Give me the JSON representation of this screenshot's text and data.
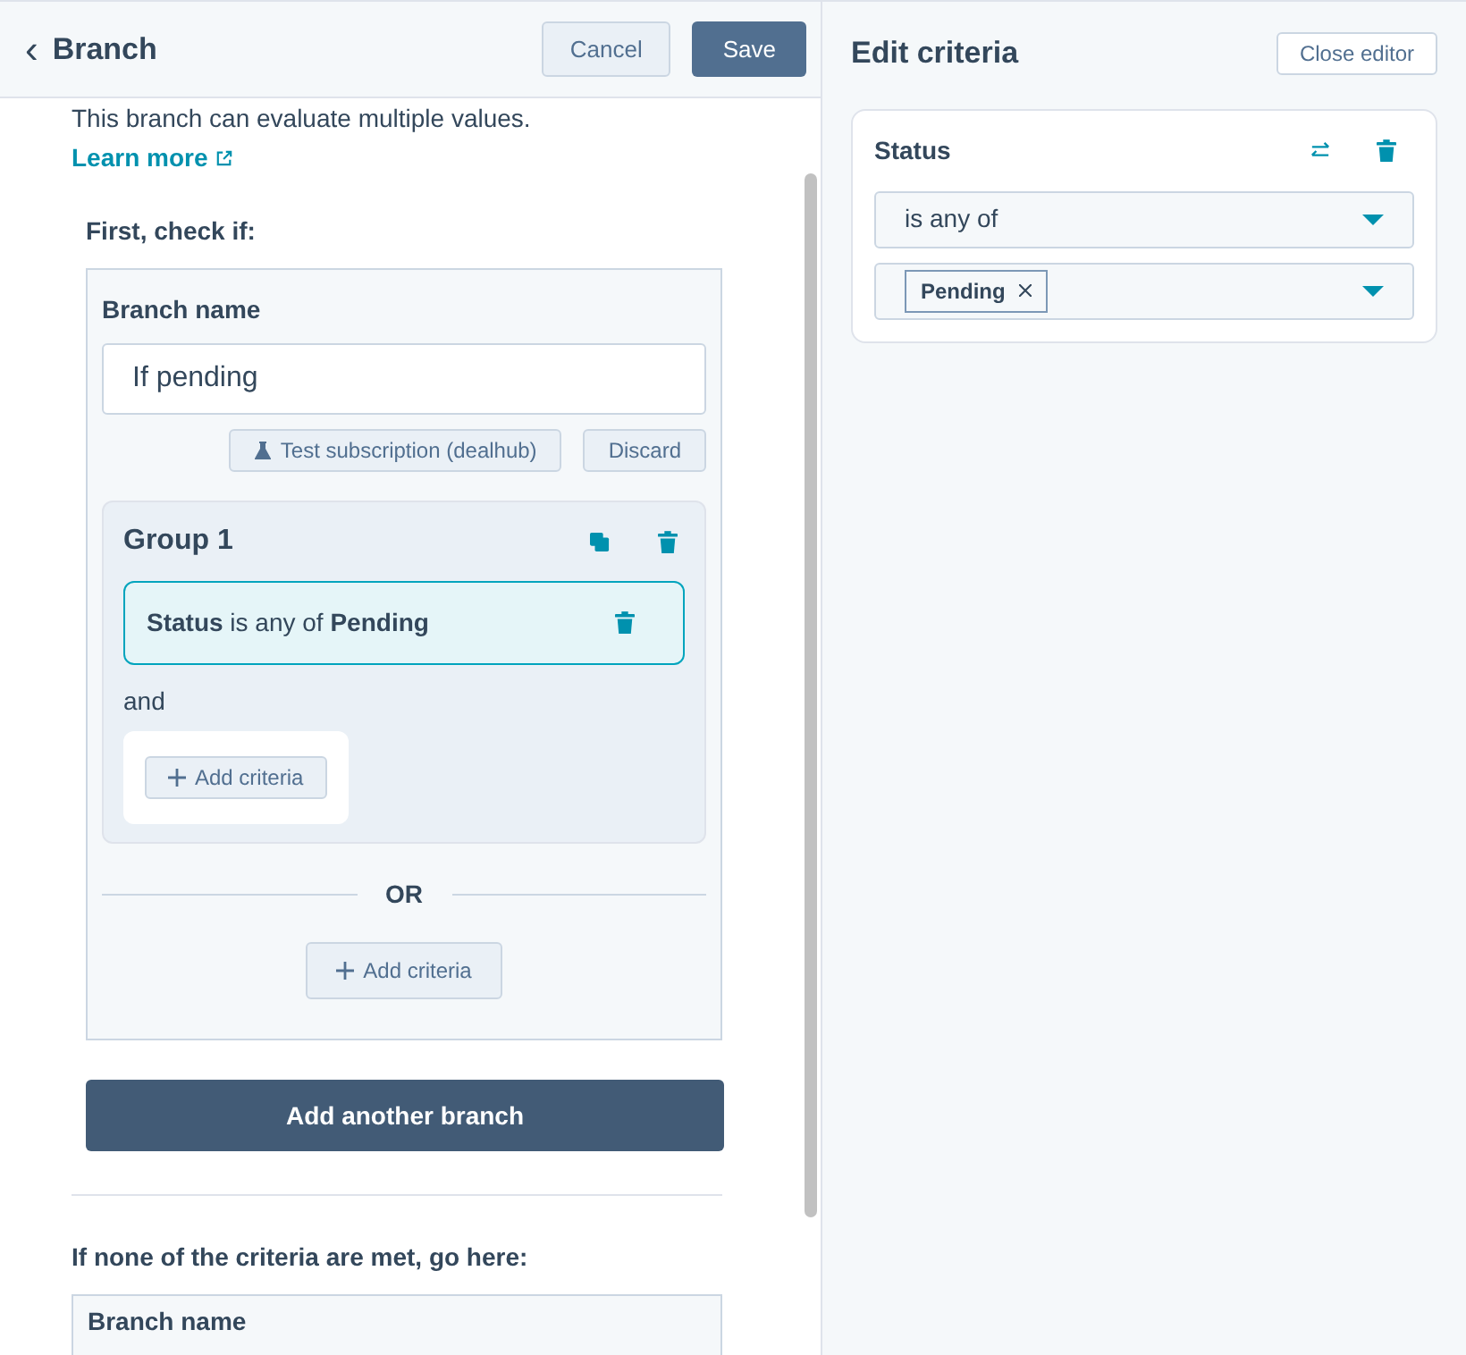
{
  "header": {
    "back": "‹",
    "title": "Branch",
    "buttons": [
      {
        "label": "Cancel",
        "kind": "secondary"
      },
      {
        "label": "Save",
        "kind": "primary"
      }
    ]
  },
  "intro": {
    "text": "This branch can evaluate multiple values.",
    "link": "Learn more"
  },
  "first_check": "First, check if:",
  "branch": {
    "name_label": "Branch name",
    "name_value": "If pending",
    "actions": [
      {
        "label": "Test subscription (dealhub)",
        "kind": "test"
      },
      {
        "label": "Discard",
        "kind": "plain"
      }
    ],
    "group": {
      "title": "Group 1",
      "criteria": [
        {
          "text": "**Status** is any of **Pending**",
          "selected": true
        }
      ],
      "joiner": "and",
      "add": "Add criteria"
    },
    "or": "OR",
    "add": "Add criteria"
  },
  "add_branch": "Add another branch",
  "fallback": {
    "label": "If none of the criteria are met, go here:",
    "name_label": "Branch name"
  },
  "editor": {
    "title": "Edit criteria",
    "close": "Close editor",
    "property": "Status",
    "operator": "is any of",
    "values": [
      "Pending"
    ]
  }
}
